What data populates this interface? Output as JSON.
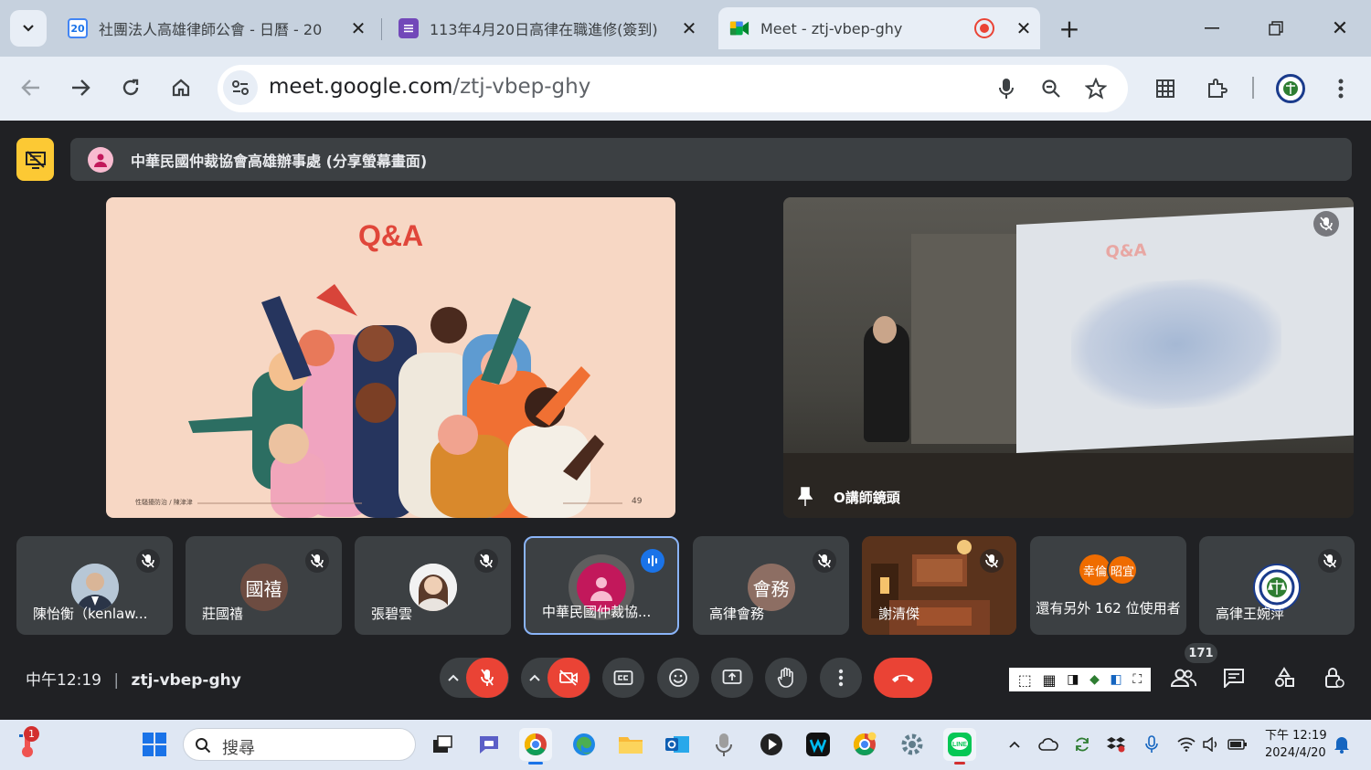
{
  "browser": {
    "tabs": [
      {
        "title": "社團法人高雄律師公會 - 日曆 - 20",
        "favicon": "calendar-icon",
        "favicon_text": "20"
      },
      {
        "title": "113年4月20日高律在職進修(簽到)",
        "favicon": "forms-icon"
      },
      {
        "title": "Meet - ztj-vbep-ghy",
        "favicon": "meet-icon"
      }
    ],
    "new_tab": "+",
    "url_host": "meet.google.com",
    "url_path": "/ztj-vbep-ghy"
  },
  "meet": {
    "presenter_banner": "中華民國仲裁協會高雄辦事處 (分享螢幕畫面)",
    "slide_title": "Q&A",
    "slide_footer": "性騷擾防治 / 陳津津",
    "slide_page": "49",
    "camera_label": "O講師鏡頭",
    "camera_slide_title": "Q&A",
    "participants": [
      {
        "name": "陳怡衡（kenlaw...",
        "avatar": "photo",
        "muted": true
      },
      {
        "name": "莊國禧",
        "avatar_text": "國禧",
        "avatar_color": "#6d4c41",
        "muted": true
      },
      {
        "name": "張碧雲",
        "avatar": "photo",
        "muted": true
      },
      {
        "name": "中華民國仲裁協...",
        "avatar": "person",
        "avatar_color": "#c2185b",
        "speaking": true
      },
      {
        "name": "高律會務",
        "avatar_text": "會務",
        "avatar_color": "#8d6e63",
        "muted": true
      },
      {
        "name": "謝清傑",
        "avatar": "room-photo",
        "muted": true
      },
      {
        "name": "還有另外 162 位使用者",
        "avatar_chips": [
          "幸倫",
          "昭宜"
        ],
        "chip_color": "#ef6c00"
      },
      {
        "name": "高律王婉萍",
        "avatar": "logo",
        "muted": true
      }
    ],
    "time": "中午12:19",
    "meeting_code": "ztj-vbep-ghy",
    "participant_count": "171",
    "accent": "#ea4335"
  },
  "taskbar": {
    "search_placeholder": "搜尋",
    "clock_time": "下午 12:19",
    "clock_date": "2024/4/20",
    "weather_badge": "1"
  }
}
